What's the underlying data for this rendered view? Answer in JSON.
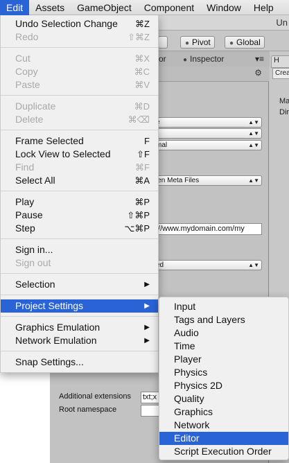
{
  "menubar": {
    "items": [
      "Edit",
      "Assets",
      "GameObject",
      "Component",
      "Window",
      "Help"
    ],
    "active": "Edit"
  },
  "background": {
    "title_fragment": "Un",
    "toolbar": {
      "pivot_label": "Pivot",
      "global_label": "Global"
    },
    "tabs": {
      "left_fragment": "or",
      "inspector_label": "Inspector",
      "hierarchy_fragment": "H"
    },
    "hierarchy": {
      "create_fragment": "Crea",
      "rows": [
        "Ma",
        "Dir"
      ]
    },
    "inspector": {
      "dropdowns": [
        "e",
        "",
        "mal",
        "len Meta Files",
        "ed"
      ],
      "url_field": "://www.mydomain.com/my",
      "additional_extensions_label": "Additional extensions",
      "additional_extensions_value": "txt;x",
      "root_namespace_label": "Root namespace",
      "root_namespace_value": ""
    }
  },
  "edit_menu": {
    "items": [
      {
        "label": "Undo Selection Change",
        "shortcut": "⌘Z",
        "enabled": true
      },
      {
        "label": "Redo",
        "shortcut": "⇧⌘Z",
        "enabled": false
      },
      {
        "label": "Cut",
        "shortcut": "⌘X",
        "enabled": false
      },
      {
        "label": "Copy",
        "shortcut": "⌘C",
        "enabled": false
      },
      {
        "label": "Paste",
        "shortcut": "⌘V",
        "enabled": false
      },
      {
        "label": "Duplicate",
        "shortcut": "⌘D",
        "enabled": false
      },
      {
        "label": "Delete",
        "shortcut": "⌘⌫",
        "enabled": false
      },
      {
        "label": "Frame Selected",
        "shortcut": "F",
        "enabled": true
      },
      {
        "label": "Lock View to Selected",
        "shortcut": "⇧F",
        "enabled": true
      },
      {
        "label": "Find",
        "shortcut": "⌘F",
        "enabled": false
      },
      {
        "label": "Select All",
        "shortcut": "⌘A",
        "enabled": true
      },
      {
        "label": "Play",
        "shortcut": "⌘P",
        "enabled": true
      },
      {
        "label": "Pause",
        "shortcut": "⇧⌘P",
        "enabled": true
      },
      {
        "label": "Step",
        "shortcut": "⌥⌘P",
        "enabled": true
      },
      {
        "label": "Sign in...",
        "shortcut": "",
        "enabled": true
      },
      {
        "label": "Sign out",
        "shortcut": "",
        "enabled": false
      },
      {
        "label": "Selection",
        "shortcut": "",
        "submenu": true,
        "enabled": true
      },
      {
        "label": "Project Settings",
        "shortcut": "",
        "submenu": true,
        "enabled": true,
        "highlighted": true
      },
      {
        "label": "Graphics Emulation",
        "shortcut": "",
        "submenu": true,
        "enabled": true
      },
      {
        "label": "Network Emulation",
        "shortcut": "",
        "submenu": true,
        "enabled": true
      },
      {
        "label": "Snap Settings...",
        "shortcut": "",
        "enabled": true
      }
    ]
  },
  "project_settings_submenu": {
    "items": [
      "Input",
      "Tags and Layers",
      "Audio",
      "Time",
      "Player",
      "Physics",
      "Physics 2D",
      "Quality",
      "Graphics",
      "Network",
      "Editor",
      "Script Execution Order"
    ],
    "highlighted": "Editor"
  },
  "colors": {
    "highlight": "#2a63d6",
    "menu_bg": "#f0f0f0",
    "disabled_text": "#a9a9a9"
  },
  "icons": {
    "submenu_arrow": "triangle-right-icon",
    "pivot": "pivot-icon",
    "global": "globe-icon",
    "inspector": "info-icon",
    "gear": "gear-icon"
  }
}
